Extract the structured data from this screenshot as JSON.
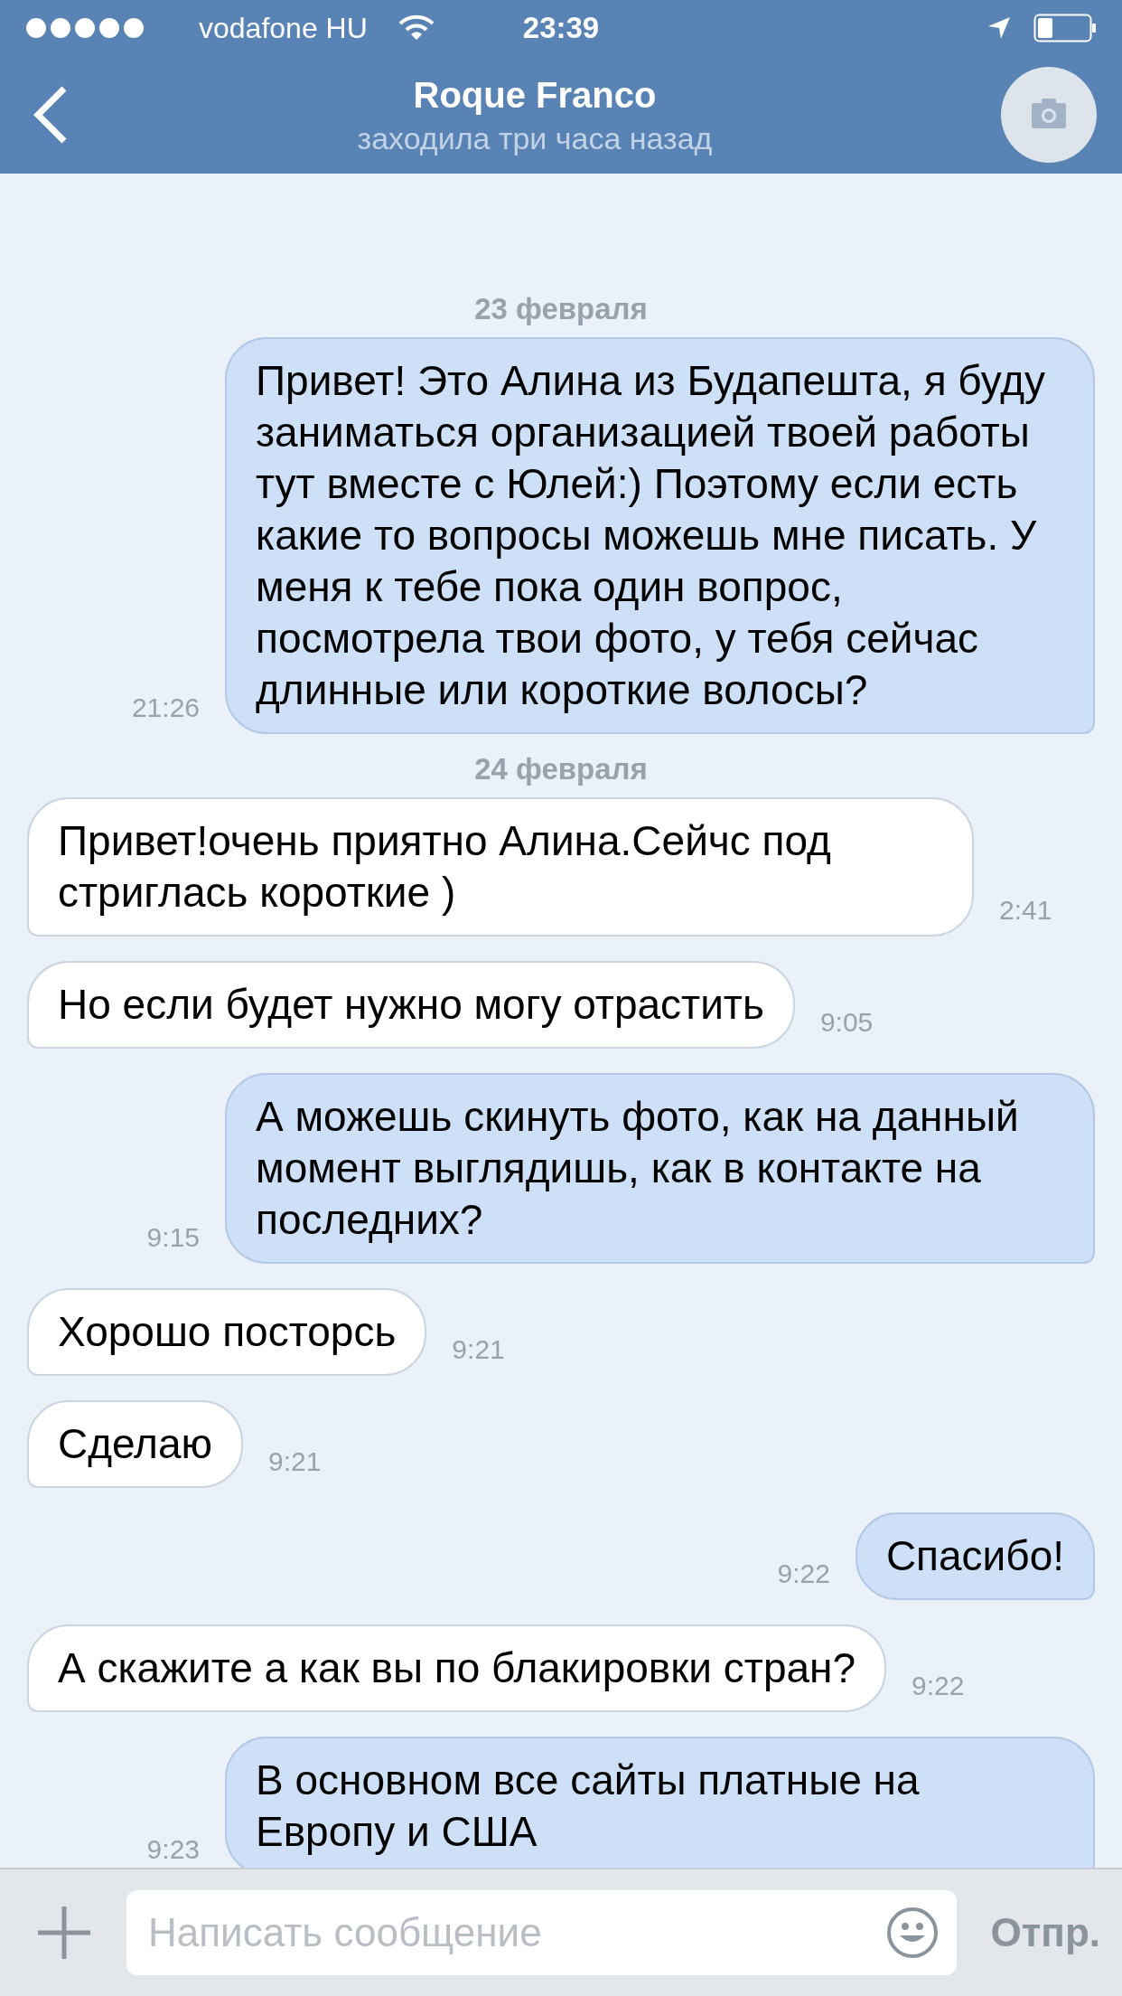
{
  "status_bar": {
    "carrier": "vodafone HU",
    "time": "23:39"
  },
  "header": {
    "title": "Roque Franco",
    "subtitle": "заходила три часа назад"
  },
  "messages": [
    {
      "kind": "date",
      "text": "23 февраля"
    },
    {
      "kind": "outgoing",
      "text": "Привет! Это Алина из Будапешта, я буду заниматься организацией твоей работы тут вместе с Юлей:) Поэтому если есть какие то вопросы можешь мне писать. У меня к тебе пока один вопрос, посмотрела твои фото, у тебя сейчас длинные или короткие волосы?",
      "time": "21:26"
    },
    {
      "kind": "date",
      "text": "24 февраля"
    },
    {
      "kind": "incoming",
      "text": "Привет!очень приятно Алина.Сейчс под стриглась короткие )",
      "time": "2:41"
    },
    {
      "kind": "incoming",
      "text": "Но если будет нужно могу отрастить",
      "time": "9:05"
    },
    {
      "kind": "outgoing",
      "text": "А можешь скинуть фото, как на данный момент выглядишь, как в контакте на последних?",
      "time": "9:15"
    },
    {
      "kind": "incoming",
      "text": "Хорошо посторсь",
      "time": "9:21"
    },
    {
      "kind": "incoming",
      "text": "Сделаю",
      "time": "9:21"
    },
    {
      "kind": "outgoing",
      "text": "Спасибо!",
      "time": "9:22"
    },
    {
      "kind": "incoming",
      "text": "А скажите а как вы по блакировки стран?",
      "time": "9:22"
    },
    {
      "kind": "outgoing",
      "text": "В основном все сайты платные на Европу и США",
      "time": "9:23"
    }
  ],
  "composer": {
    "placeholder": "Написать сообщение",
    "send": "Отпр."
  }
}
